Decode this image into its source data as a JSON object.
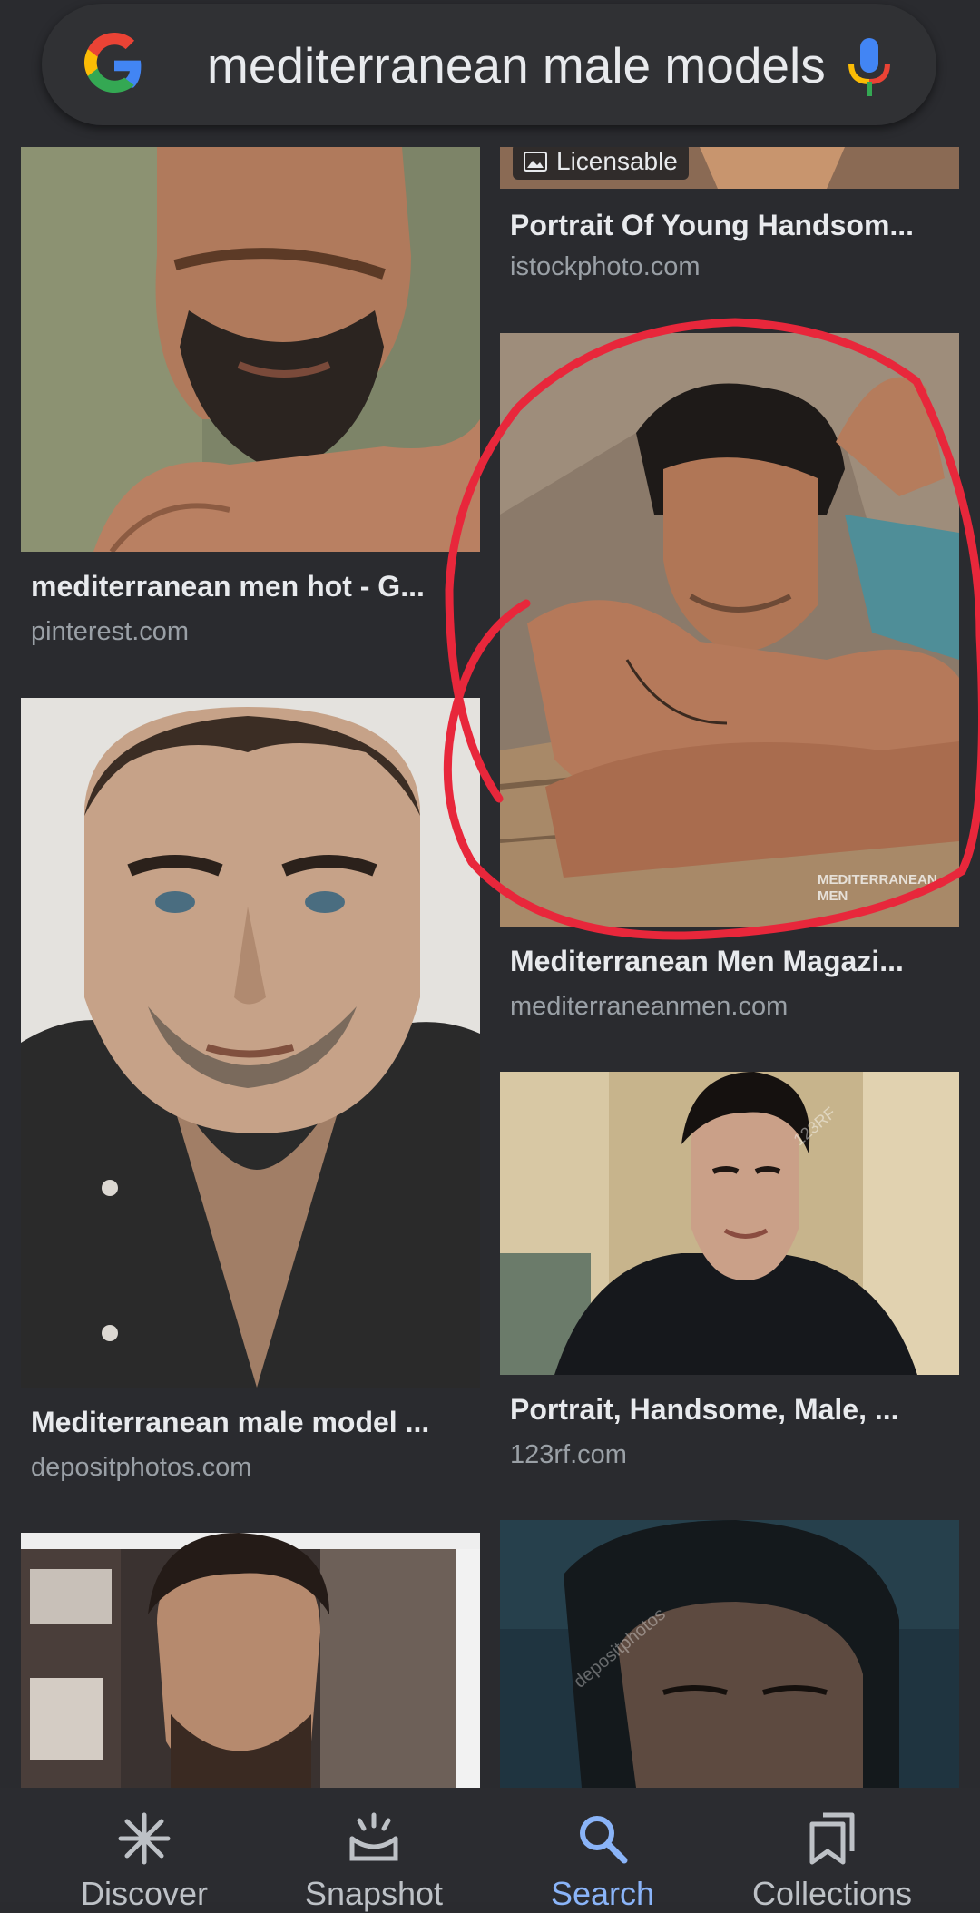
{
  "search": {
    "query": "mediterranean male models"
  },
  "results": {
    "r1": {
      "title": "mediterranean men hot - G...",
      "source": "pinterest.com"
    },
    "r2": {
      "badge": "Licensable",
      "title": "Portrait Of Young Handsom...",
      "source": "istockphoto.com"
    },
    "r3": {
      "title": "Mediterranean Men Magazi...",
      "source": "mediterraneanmen.com",
      "watermark": "MEDITERRANEAN MEN"
    },
    "r4": {
      "title": "Mediterranean male model ...",
      "source": "depositphotos.com"
    },
    "r5": {
      "title": "Portrait, Handsome, Male, ...",
      "source": "123rf.com",
      "watermark": "123RF"
    },
    "r6": {
      "watermark": "depositphotos"
    }
  },
  "nav": {
    "discover": "Discover",
    "snapshot": "Snapshot",
    "search": "Search",
    "collections": "Collections"
  },
  "colors": {
    "background": "#2a2b2f",
    "accent": "#8ab4f8",
    "annotation": "#e8273b"
  },
  "icons": [
    "google-logo-icon",
    "microphone-icon",
    "discover-icon",
    "snapshot-icon",
    "search-icon",
    "collections-icon",
    "image-icon"
  ]
}
